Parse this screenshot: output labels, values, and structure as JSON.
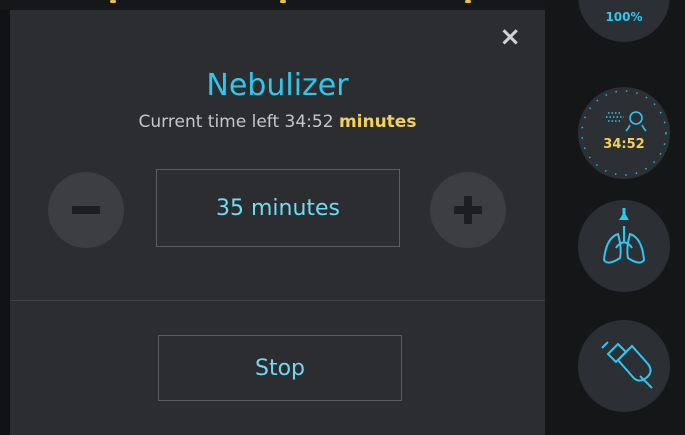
{
  "dialog": {
    "title": "Nebulizer",
    "subtitle_text": "Current time left 34:52",
    "subtitle_unit": "minutes",
    "close_label": "×",
    "duration_value": "35 minutes",
    "stop_label": "Stop"
  },
  "rail": {
    "battery_percent": "100%",
    "nebulizer_time": "34:52"
  },
  "colors": {
    "accent_cyan": "#2ec7ee",
    "accent_yellow": "#f1d15a",
    "panel_bg": "#2b2d30"
  },
  "icons": [
    "close-icon",
    "minus-icon",
    "plus-icon",
    "nebulizer-icon",
    "lungs-icon",
    "syringe-icon"
  ]
}
